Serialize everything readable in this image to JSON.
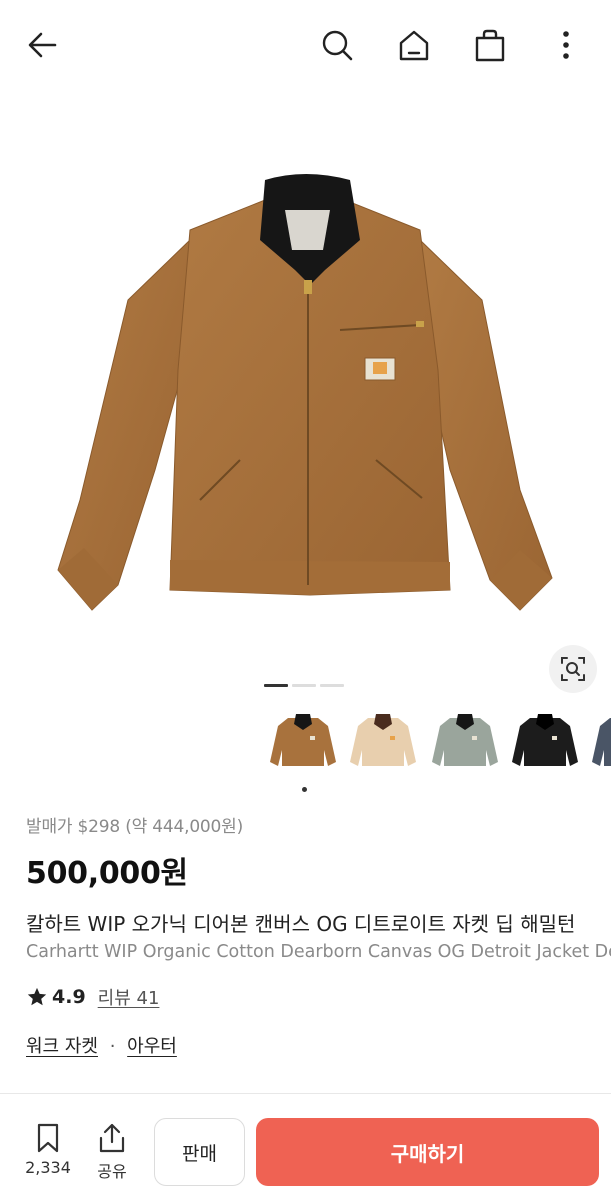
{
  "colors": {
    "accent": "#ef6253",
    "jacket_brown": "#a8723d",
    "collar": "#1a1a1a"
  },
  "icons": {
    "back": "arrow-left-icon",
    "search": "search-icon",
    "home": "home-icon",
    "bag": "shopping-bag-icon",
    "more": "more-vertical-icon",
    "lens": "image-search-icon",
    "bookmark": "bookmark-icon",
    "share": "share-icon",
    "star": "star-icon"
  },
  "gallery": {
    "current_page": 1,
    "page_count": 3,
    "thumbnails": [
      {
        "color": "brown",
        "selected": true
      },
      {
        "color": "beige",
        "selected": false
      },
      {
        "color": "grey-green",
        "selected": false
      },
      {
        "color": "black",
        "selected": false
      },
      {
        "color": "navy",
        "selected": false
      }
    ]
  },
  "product": {
    "release_price": "발매가 $298 (약 444,000원)",
    "price": "500,000원",
    "title_ko": "칼하트 WIP 오가닉 디어본 캔버스 OG 디트로이트 자켓 딥 해밀턴",
    "title_en": "Carhartt WIP Organic Cotton Dearborn Canvas OG Detroit Jacket Deep H",
    "rating": "4.9",
    "reviews": "리뷰 41",
    "category_1": "워크 자켓",
    "category_sep": "·",
    "category_2": "아우터"
  },
  "bottom_bar": {
    "bookmark_count": "2,334",
    "share_label": "공유",
    "sell_label": "판매",
    "buy_label": "구매하기"
  }
}
